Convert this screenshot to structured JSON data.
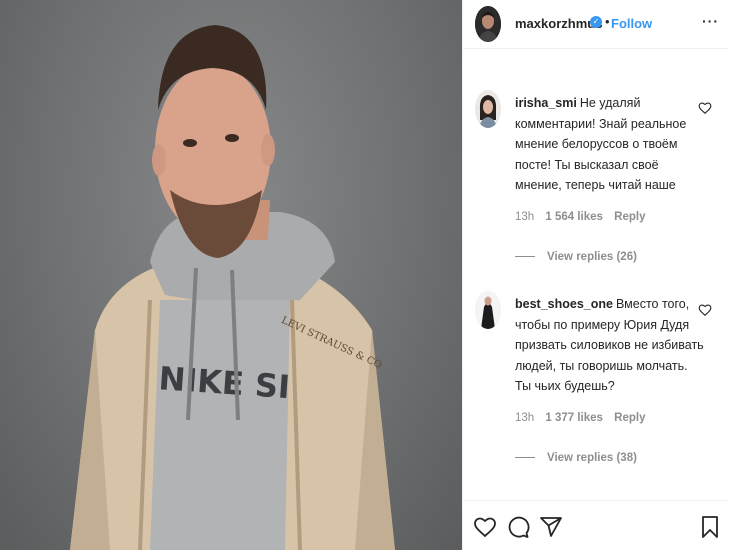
{
  "post": {
    "username": "maxkorzhmus",
    "follow_label": "Follow",
    "more_label": "···"
  },
  "comments": [
    {
      "username": "irisha_smi",
      "text": "Не удаляй комментарии! Знай реальное мнение белоруссов о твоём посте! Ты высказал своё мнение, теперь читай наше",
      "time": "13h",
      "likes": "1 564 likes",
      "reply_label": "Reply",
      "view_replies": "View replies (26)"
    },
    {
      "username": "best_shoes_one",
      "text": "Вместо того, чтобы по примеру Юрия Дудя призвать силовиков не избивать людей, ты говоришь молчать. Ты чьих будешь?",
      "time": "13h",
      "likes": "1 377 likes",
      "reply_label": "Reply",
      "view_replies": "View replies (38)"
    }
  ],
  "photo": {
    "shirt_print": "NIKE SI",
    "patch_text": "LEVI STRAUSS & CO"
  },
  "icons": {
    "like": "heart-icon",
    "comment": "comment-icon",
    "share": "share-icon",
    "save": "bookmark-icon",
    "verified": "verified-badge-icon",
    "more": "more-options-icon"
  },
  "colors": {
    "link_blue": "#3897f0",
    "text_dark": "#262626",
    "text_gray": "#8e8e8e",
    "border": "#efefef"
  }
}
